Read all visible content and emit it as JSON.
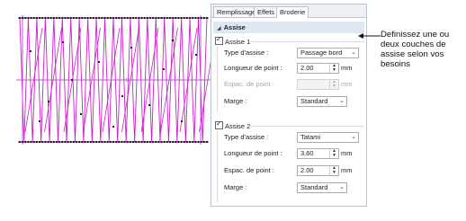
{
  "tabs": [
    {
      "label": "Remplissage",
      "active": false
    },
    {
      "label": "Effets",
      "active": false
    },
    {
      "label": "Broderie",
      "active": true
    }
  ],
  "section": {
    "title": "Assise",
    "expanded": true
  },
  "underlay1": {
    "label": "Assise 1",
    "checked": true,
    "type_label": "Type d'assise :",
    "type_value": "Passage bord",
    "stitch_length_label": "Longueur de point :",
    "stitch_length_value": "2.00",
    "stitch_length_unit": "mm",
    "spacing_label": "Espac. de point :",
    "spacing_value": "",
    "spacing_unit": "mm",
    "spacing_enabled": false,
    "margin_label": "Marge :",
    "margin_value": "Standard"
  },
  "underlay2": {
    "label": "Assise 2",
    "checked": true,
    "type_label": "Type d'assise :",
    "type_value": "Tatami",
    "stitch_length_label": "Longueur de point :",
    "stitch_length_value": "3.60",
    "stitch_length_unit": "mm",
    "spacing_label": "Espac. de point :",
    "spacing_value": "2.00",
    "spacing_unit": "mm",
    "margin_label": "Marge :",
    "margin_value": "Standard"
  },
  "callout": {
    "text": "Definissez une ou deux couches de assise selon vos besoins"
  },
  "icons": {
    "section_toggle": "triangle-down-icon",
    "combo_arrow": "chevron-down-icon",
    "spin_up": "spin-up-icon",
    "spin_down": "spin-down-icon",
    "checkbox": "checkmark-icon"
  },
  "colors": {
    "stitch": "#cc1fcc",
    "guide_line": "#c84ee0",
    "panel_border": "#b8c4d2",
    "section_bg": "#dfe7f1"
  }
}
